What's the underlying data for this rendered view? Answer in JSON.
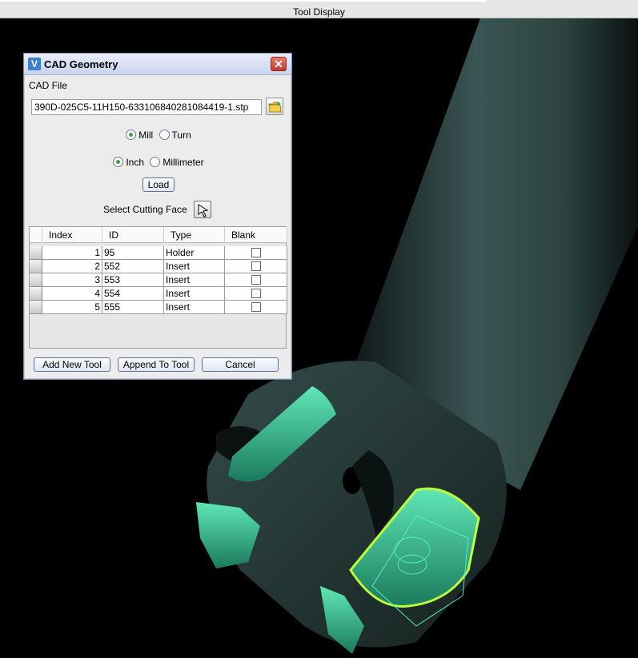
{
  "window_title": "Tool Display",
  "dialog": {
    "title": "CAD Geometry",
    "close_glyph": "✕",
    "cad_file_label": "CAD File",
    "cad_file_value": "390D-025C5-11H150-633106840281084419-1.stp",
    "mode_options": [
      {
        "label": "Mill",
        "selected": true
      },
      {
        "label": "Turn",
        "selected": false
      }
    ],
    "unit_options": [
      {
        "label": "Inch",
        "selected": true
      },
      {
        "label": "Millimeter",
        "selected": false
      }
    ],
    "load_label": "Load",
    "select_face_label": "Select Cutting Face",
    "table": {
      "headers": [
        "Index",
        "ID",
        "Type",
        "Blank"
      ],
      "rows": [
        {
          "index": "1",
          "id": "95",
          "type": "Holder",
          "blank": false
        },
        {
          "index": "2",
          "id": "552",
          "type": "Insert",
          "blank": false
        },
        {
          "index": "3",
          "id": "553",
          "type": "Insert",
          "blank": false
        },
        {
          "index": "4",
          "id": "554",
          "type": "Insert",
          "blank": false
        },
        {
          "index": "5",
          "id": "555",
          "type": "Insert",
          "blank": false
        }
      ]
    },
    "buttons": {
      "add_new_tool": "Add New Tool",
      "append_to_tool": "Append To Tool",
      "cancel": "Cancel"
    }
  },
  "colors": {
    "tool_body": "#2d4442",
    "insert_green": "#2aa37e",
    "selected_outline": "#b9ff3b",
    "wireframe": "#4ff0c0"
  }
}
